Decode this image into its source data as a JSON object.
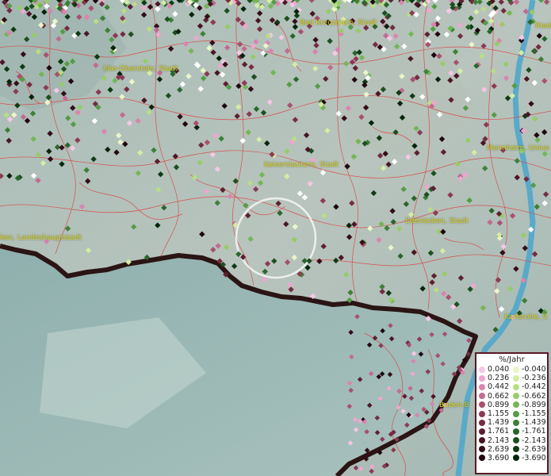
{
  "map": {
    "labels": {
      "bad_kreuznach": "Bad Kreuznach, Stadt",
      "ried": "Ried",
      "idar_oberstein": "Idar-Oberstein, Stadt",
      "mannheim": "Mannheim, Unive",
      "kaiserslautern": "Kaiserslautern, Stadt",
      "edenkoben": "Edenkoben, Stadt",
      "landeshauptstadt": "ken, Landeshauptstadt",
      "karlsruhe": "Karlsruhe, S",
      "baden": "Baden-B"
    },
    "colors": {
      "water": "#5aa9c9",
      "boundary": "#e03a3a",
      "border_dark": "#2a1414",
      "terrain": "#9fb7b4"
    }
  },
  "legend": {
    "title": "%/Jahr",
    "positive": [
      "0.040",
      "0.236",
      "0.442",
      "0.662",
      "0.899",
      "1.155",
      "1.439",
      "1.761",
      "2.143",
      "2.639",
      "3.690"
    ],
    "negative": [
      "-0.040",
      "-0.236",
      "-0.442",
      "-0.662",
      "-0.899",
      "-1.155",
      "-1.439",
      "-1.761",
      "-2.143",
      "-2.639",
      "-3.690"
    ],
    "positive_colors": [
      "#f7c6e6",
      "#eea7cf",
      "#d985b0",
      "#c36a92",
      "#a8506f",
      "#8c3a55",
      "#742c42",
      "#5e1f31",
      "#4a1524",
      "#350c18",
      "#210610"
    ],
    "negative_colors": [
      "#eaf6c8",
      "#d4eda4",
      "#b8de84",
      "#96cc68",
      "#74b655",
      "#549c45",
      "#3d8138",
      "#2a662c",
      "#1c4f20",
      "#0f3a14",
      "#06240b"
    ]
  }
}
